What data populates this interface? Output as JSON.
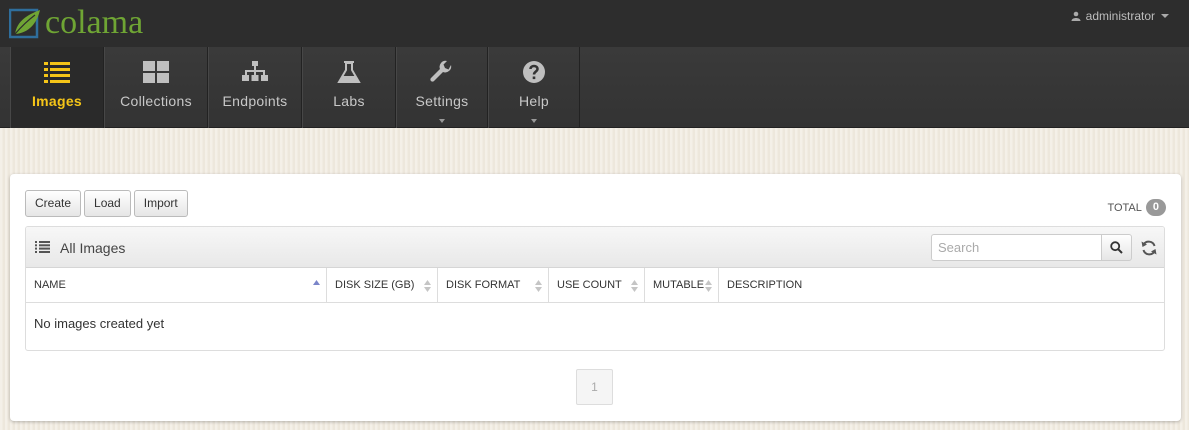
{
  "app": {
    "logo_text": "colama",
    "user": "administrator"
  },
  "nav": [
    {
      "label": "Images",
      "icon": "list-icon",
      "active": true
    },
    {
      "label": "Collections",
      "icon": "grid-icon"
    },
    {
      "label": "Endpoints",
      "icon": "sitemap-icon"
    },
    {
      "label": "Labs",
      "icon": "flask-icon"
    },
    {
      "label": "Settings",
      "icon": "wrench-icon",
      "dropdown": true
    },
    {
      "label": "Help",
      "icon": "question-icon",
      "dropdown": true
    }
  ],
  "toolbar": {
    "create_label": "Create",
    "load_label": "Load",
    "import_label": "Import",
    "total_label": "TOTAL",
    "total_count": "0"
  },
  "images_box": {
    "title": "All Images",
    "search_placeholder": "Search",
    "columns": [
      "NAME",
      "DISK SIZE (GB)",
      "DISK FORMAT",
      "USE COUNT",
      "MUTABLE",
      "DESCRIPTION"
    ],
    "empty_message": "No images created yet"
  },
  "pagination": {
    "current_page": "1"
  },
  "colors": {
    "accent": "#f5c518",
    "brand_green": "#6fa534",
    "topbar": "#2d2d2d",
    "sort_active": "#7a85c9"
  }
}
